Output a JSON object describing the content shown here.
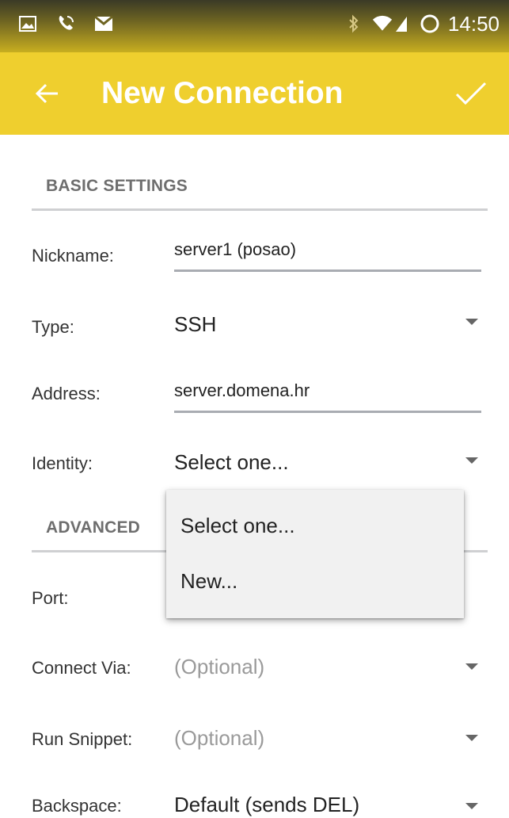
{
  "status_bar": {
    "time": "14:50",
    "icons": [
      "image-icon",
      "phone-icon",
      "mail-icon",
      "bluetooth-icon",
      "wifi-icon",
      "signal-icon",
      "circle-icon"
    ]
  },
  "toolbar": {
    "back_icon": "arrow-left-icon",
    "title": "New Connection",
    "confirm_icon": "check-icon",
    "color": "#efcf2e"
  },
  "basic_settings": {
    "header": "BASIC SETTINGS",
    "nickname": {
      "label": "Nickname:",
      "value": "server1 (posao)"
    },
    "type": {
      "label": "Type:",
      "value": "SSH"
    },
    "address": {
      "label": "Address:",
      "value": "server.domena.hr"
    },
    "identity": {
      "label": "Identity:",
      "value": "Select one..."
    }
  },
  "advanced": {
    "header": "ADVANCED",
    "port": {
      "label": "Port:"
    },
    "connect_via": {
      "label": "Connect Via:",
      "value": "(Optional)"
    },
    "run_snippet": {
      "label": "Run Snippet:",
      "value": "(Optional)"
    },
    "backspace": {
      "label": "Backspace:",
      "value": "Default (sends DEL)"
    }
  },
  "identity_dropdown": {
    "options": [
      "Select one...",
      "New..."
    ]
  }
}
